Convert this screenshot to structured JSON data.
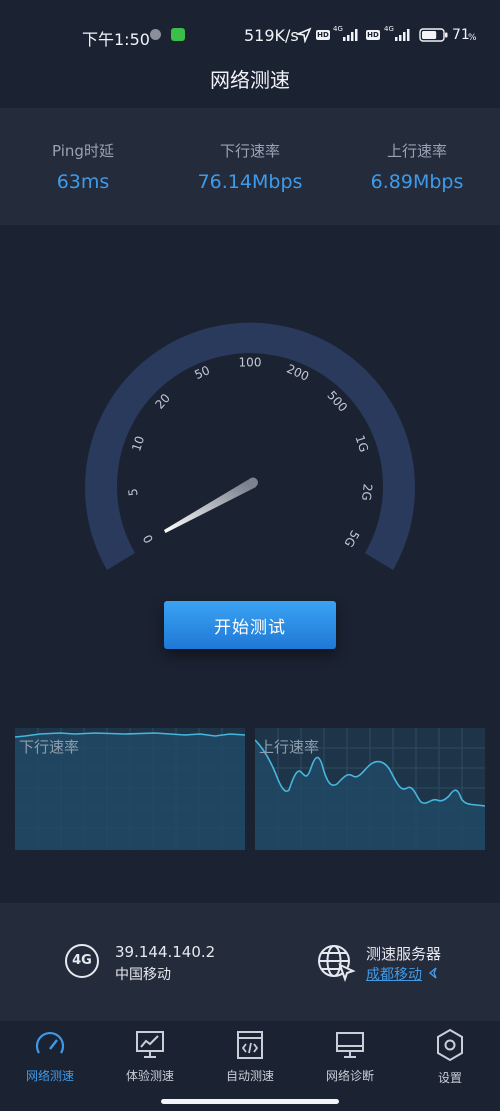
{
  "status_bar": {
    "time": "下午1:50",
    "speed": "519K/s",
    "net1": "4G",
    "net2": "4G",
    "battery": "71",
    "battery_pct": 71
  },
  "title": "网络测速",
  "stats": [
    {
      "label": "Ping时延",
      "value": "63ms"
    },
    {
      "label": "下行速率",
      "value": "76.14Mbps"
    },
    {
      "label": "上行速率",
      "value": "6.89Mbps"
    }
  ],
  "gauge": {
    "ticks": [
      "0",
      "5",
      "10",
      "20",
      "50",
      "100",
      "200",
      "500",
      "1G",
      "2G",
      "5G"
    ]
  },
  "start_button": "开始测试",
  "charts": {
    "download_title": "下行速率",
    "upload_title": "上行速率"
  },
  "network": {
    "badge": "4G",
    "ip": "39.144.140.2",
    "carrier": "中国移动",
    "server_label": "测速服务器",
    "server_name": "成都移动"
  },
  "tabs": [
    {
      "label": "网络测速",
      "icon": "speedometer-icon"
    },
    {
      "label": "体验测速",
      "icon": "monitor-chart-icon"
    },
    {
      "label": "自动测速",
      "icon": "code-window-icon"
    },
    {
      "label": "网络诊断",
      "icon": "monitor-icon"
    },
    {
      "label": "设置",
      "icon": "hexagon-settings-icon"
    }
  ],
  "colors": {
    "background": "#1b2232",
    "panel": "#242b3b",
    "accent": "#3f9bea",
    "gauge_arc": "#2a3a5c"
  }
}
